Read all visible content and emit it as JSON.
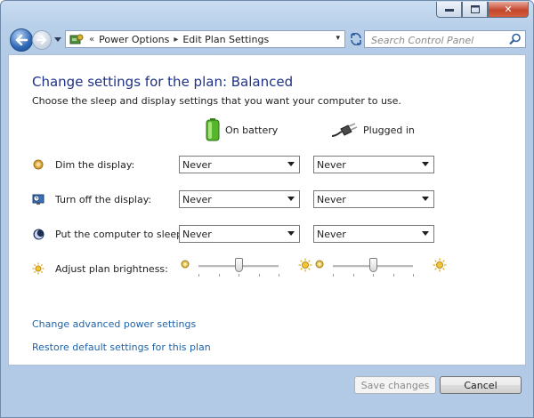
{
  "window": {
    "caption_buttons": {
      "minimize": "▭",
      "maximize": "□",
      "close": "✕"
    }
  },
  "nav": {
    "breadcrumb": [
      "Power Options",
      "Edit Plan Settings"
    ],
    "overflow": "«",
    "separator": "▸",
    "dropdown_glyph": "▾",
    "search_placeholder": "Search Control Panel",
    "icons": {
      "back": "back-arrow-icon",
      "forward": "forward-arrow-icon",
      "refresh": "refresh-icon",
      "search": "search-icon"
    }
  },
  "page": {
    "title": "Change settings for the plan: Balanced",
    "subtitle": "Choose the sleep and display settings that you want your computer to use.",
    "columns": [
      {
        "label": "On battery",
        "icon": "battery-icon"
      },
      {
        "label": "Plugged in",
        "icon": "power-plug-icon"
      }
    ],
    "settings": [
      {
        "label": "Dim the display:",
        "icon": "dim-display-icon",
        "battery": "Never",
        "plugged": "Never"
      },
      {
        "label": "Turn off the display:",
        "icon": "display-off-icon",
        "battery": "Never",
        "plugged": "Never"
      },
      {
        "label": "Put the computer to sleep:",
        "icon": "sleep-moon-icon",
        "battery": "Never",
        "plugged": "Never"
      }
    ],
    "brightness": {
      "label": "Adjust plan brightness:",
      "icon": "brightness-sun-icon",
      "battery_level": 0.5,
      "plugged_level": 0.5
    },
    "links": {
      "advanced": "Change advanced power settings",
      "restore": "Restore default settings for this plan"
    },
    "buttons": {
      "save": "Save changes",
      "cancel": "Cancel"
    }
  }
}
